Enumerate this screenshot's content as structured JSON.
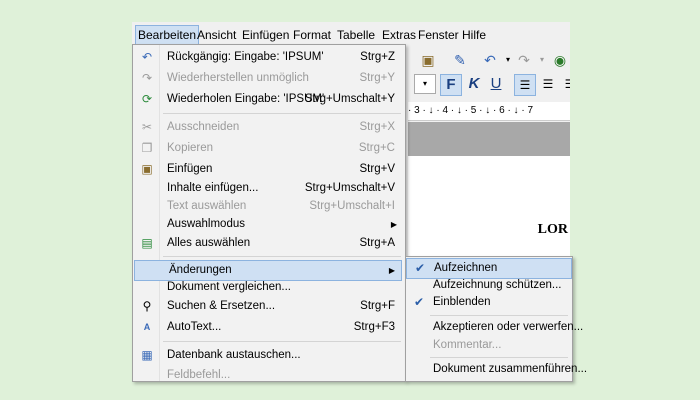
{
  "menubar": {
    "items": [
      "Bearbeiten",
      "Ansicht",
      "Einfügen",
      "Format",
      "Tabelle",
      "Extras",
      "Fenster",
      "Hilfe"
    ]
  },
  "toolbar": {
    "format_buttons": [
      "F",
      "K",
      "U"
    ],
    "ruler_text": "· 3 · ↓ · 4 · ↓ · 5 · ↓ · 6 · ↓ · 7"
  },
  "document": {
    "text": "LOR"
  },
  "edit_menu": {
    "items": [
      {
        "label": "Rückgängig: Eingabe: 'IPSUM'",
        "shortcut": "Strg+Z"
      },
      {
        "label": "Wiederherstellen unmöglich",
        "shortcut": "Strg+Y"
      },
      {
        "label": "Wiederholen Eingabe: 'IPSUM'",
        "shortcut": "Strg+Umschalt+Y"
      },
      {
        "label": "Ausschneiden",
        "shortcut": "Strg+X"
      },
      {
        "label": "Kopieren",
        "shortcut": "Strg+C"
      },
      {
        "label": "Einfügen",
        "shortcut": "Strg+V"
      },
      {
        "label": "Inhalte einfügen...",
        "shortcut": "Strg+Umschalt+V"
      },
      {
        "label": "Text auswählen",
        "shortcut": "Strg+Umschalt+I"
      },
      {
        "label": "Auswahlmodus",
        "shortcut": ""
      },
      {
        "label": "Alles auswählen",
        "shortcut": "Strg+A"
      },
      {
        "label": "Änderungen",
        "shortcut": ""
      },
      {
        "label": "Dokument vergleichen...",
        "shortcut": ""
      },
      {
        "label": "Suchen & Ersetzen...",
        "shortcut": "Strg+F"
      },
      {
        "label": "AutoText...",
        "shortcut": "Strg+F3"
      },
      {
        "label": "Datenbank austauschen...",
        "shortcut": ""
      },
      {
        "label": "Feldbefehl...",
        "shortcut": ""
      }
    ]
  },
  "changes_submenu": {
    "items": [
      {
        "label": "Aufzeichnen"
      },
      {
        "label": "Aufzeichnung schützen..."
      },
      {
        "label": "Einblenden"
      },
      {
        "label": "Akzeptieren oder verwerfen..."
      },
      {
        "label": "Kommentar..."
      },
      {
        "label": "Dokument zusammenführen..."
      }
    ]
  }
}
